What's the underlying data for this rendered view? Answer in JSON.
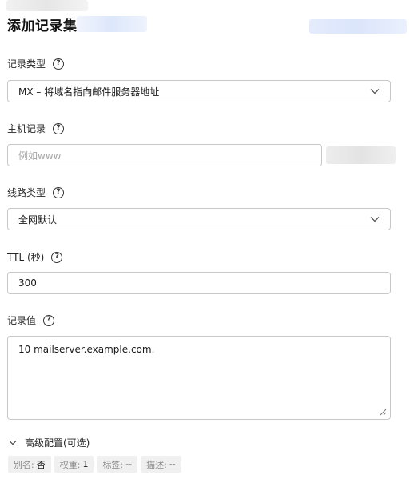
{
  "header": {
    "title": "添加记录集"
  },
  "form": {
    "record_type": {
      "label": "记录类型",
      "value": "MX – 将域名指向邮件服务器地址"
    },
    "host": {
      "label": "主机记录",
      "placeholder": "例如www"
    },
    "line_type": {
      "label": "线路类型",
      "value": "全网默认"
    },
    "ttl": {
      "label": "TTL (秒)",
      "value": "300"
    },
    "record_value": {
      "label": "记录值",
      "value": "10 mailserver.example.com."
    }
  },
  "advanced": {
    "label": "高级配置(可选)",
    "tags": [
      {
        "key": "别名:",
        "value": "否"
      },
      {
        "key": "权重:",
        "value": "1"
      },
      {
        "key": "标签:",
        "value": "--"
      },
      {
        "key": "描述:",
        "value": "--"
      }
    ]
  },
  "icons": {
    "help": "question-circle-icon",
    "select_arrow": "chevron-down-icon",
    "expand": "chevron-down-icon",
    "resize": "resize-handle-icon"
  }
}
